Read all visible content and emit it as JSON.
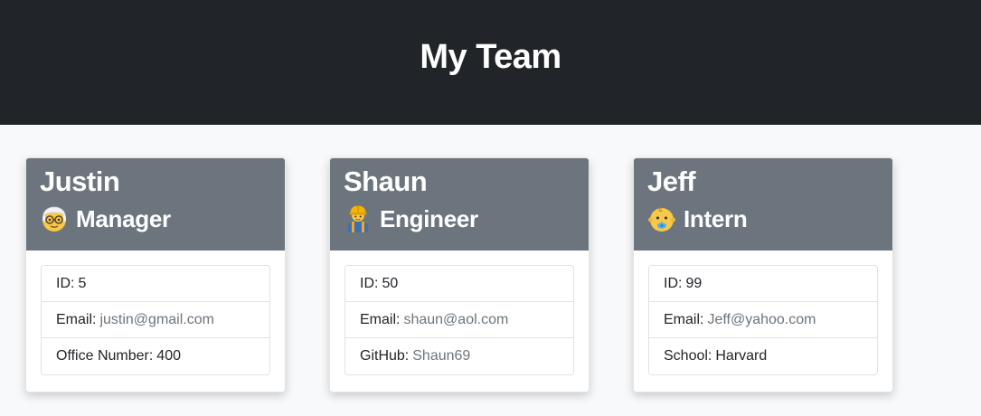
{
  "header": {
    "title": "My Team"
  },
  "team": [
    {
      "name": "Justin",
      "role": "Manager",
      "icon": "older-person-icon",
      "id_label": "ID:",
      "id_value": "5",
      "email_label": "Email:",
      "email_value": "justin@gmail.com",
      "extra_label": "Office Number:",
      "extra_value": "400"
    },
    {
      "name": "Shaun",
      "role": "Engineer",
      "icon": "construction-worker-icon",
      "id_label": "ID:",
      "id_value": "50",
      "email_label": "Email:",
      "email_value": "shaun@aol.com",
      "extra_label": "GitHub:",
      "extra_value": "Shaun69"
    },
    {
      "name": "Jeff",
      "role": "Intern",
      "icon": "baby-icon",
      "id_label": "ID:",
      "id_value": "99",
      "email_label": "Email:",
      "email_value": "Jeff@yahoo.com",
      "extra_label": "School:",
      "extra_value": "Harvard"
    }
  ],
  "colors": {
    "header_bg": "#212529",
    "card_header_bg": "#6c757d",
    "page_bg": "#f8f9fa",
    "link_text": "#6c757d"
  }
}
